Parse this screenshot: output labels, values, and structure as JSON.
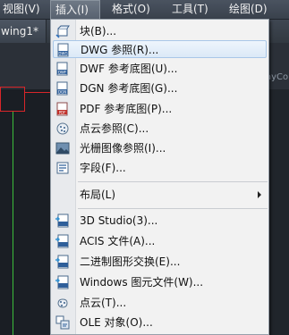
{
  "menubar": {
    "items": [
      {
        "label": "视图(V)"
      },
      {
        "label": "插入(I)",
        "active": true
      },
      {
        "label": "格式(O)"
      },
      {
        "label": "工具(T)"
      },
      {
        "label": "绘图(D)"
      }
    ]
  },
  "document_tab": {
    "label": "wing1*"
  },
  "ribbon_tail": {
    "label": "ayCol"
  },
  "insert_menu": {
    "items": [
      {
        "label": "块(B)...",
        "icon": "block-icon"
      },
      {
        "label": "DWG 参照(R)...",
        "icon": "dwg-reference-icon",
        "highlighted": true
      },
      {
        "label": "DWF 参考底图(U)...",
        "icon": "dwf-underlay-icon"
      },
      {
        "label": "DGN 参考底图(G)...",
        "icon": "dgn-underlay-icon"
      },
      {
        "label": "PDF 参考底图(P)...",
        "icon": "pdf-underlay-icon"
      },
      {
        "label": "点云参照(C)...",
        "icon": "point-cloud-reference-icon"
      },
      {
        "label": "光栅图像参照(I)...",
        "icon": "raster-image-icon"
      },
      {
        "label": "字段(F)...",
        "icon": "field-icon"
      },
      {
        "label": "布局(L)",
        "icon": "",
        "submenu": true
      },
      {
        "label": "3D Studio(3)...",
        "icon": "3ds-import-icon"
      },
      {
        "label": "ACIS 文件(A)...",
        "icon": "acis-import-icon"
      },
      {
        "label": "二进制图形交换(E)...",
        "icon": "dxb-import-icon"
      },
      {
        "label": "Windows 图元文件(W)...",
        "icon": "wmf-import-icon"
      },
      {
        "label": "点云(T)...",
        "icon": "point-cloud-icon"
      },
      {
        "label": "OLE 对象(O)...",
        "icon": "ole-object-icon"
      }
    ]
  },
  "colors": {
    "menubar_bg": "#3f4752",
    "menu_bg": "#f2f2f2",
    "highlight_border": "#a9c7e8",
    "canvas_bg": "#1a1e24",
    "red_line": "#d8262a",
    "green_line": "#3bbd3b"
  }
}
